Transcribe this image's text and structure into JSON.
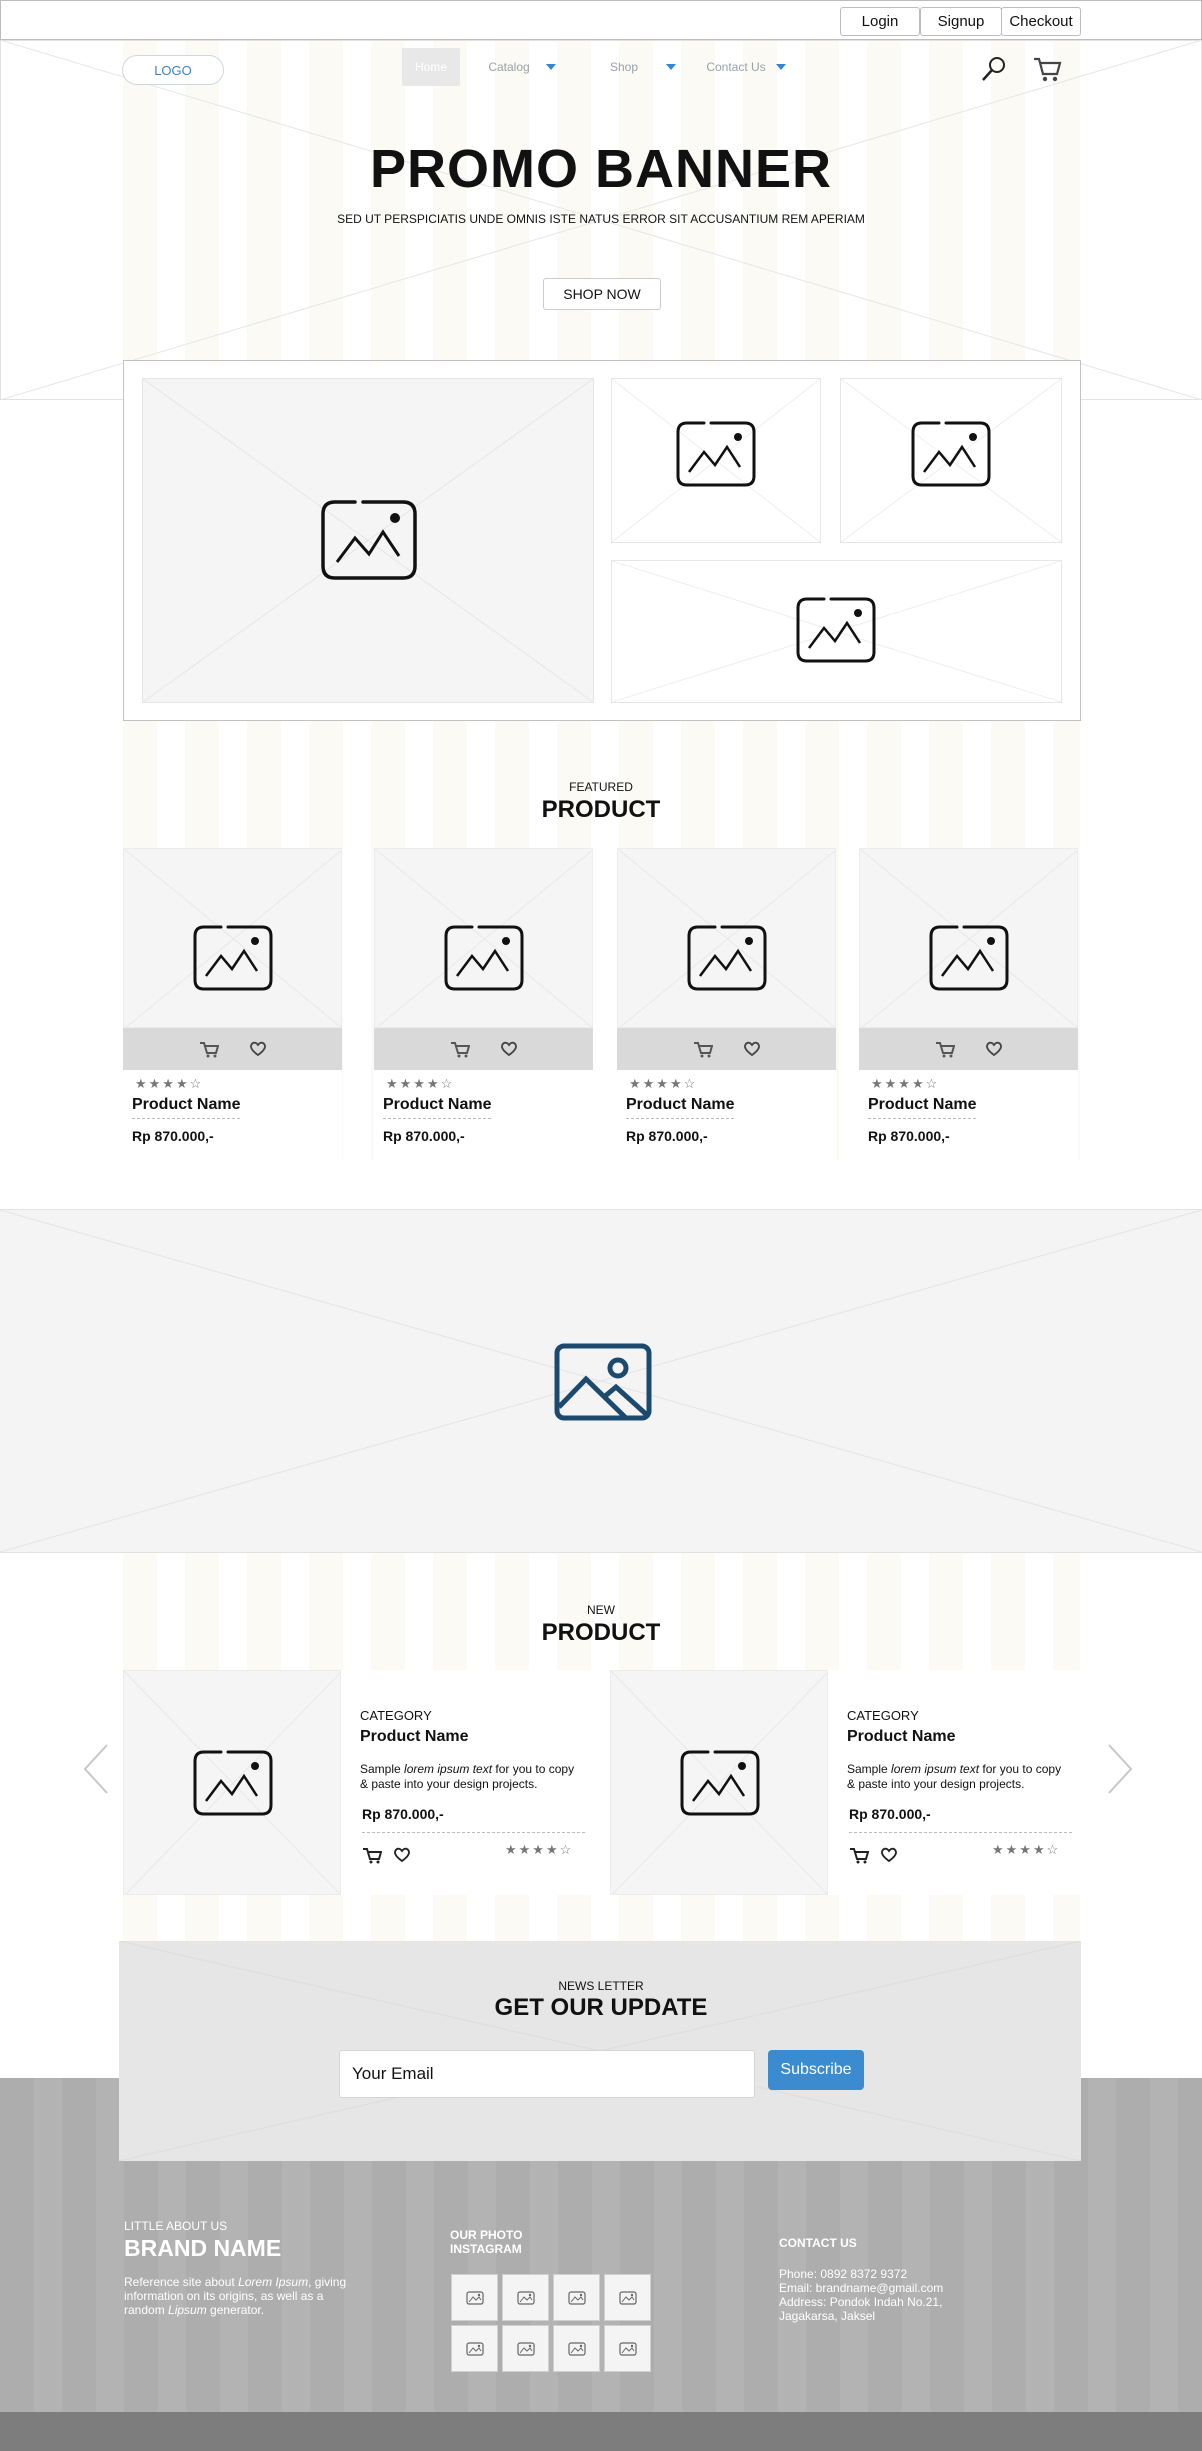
{
  "topbar": {
    "login": "Login",
    "signup": "Signup",
    "checkout": "Checkout"
  },
  "header": {
    "logo": "LOGO",
    "nav": [
      {
        "label": "Home",
        "active": true
      },
      {
        "label": "Catalog"
      },
      {
        "label": "Shop"
      },
      {
        "label": "Contact Us"
      }
    ]
  },
  "hero": {
    "title": "PROMO BANNER",
    "subtitle": "SED UT PERSPICIATIS UNDE OMNIS ISTE NATUS ERROR SIT ACCUSANTIUM REM APERIAM",
    "button": "SHOP NOW"
  },
  "featured": {
    "small": "FEATURED",
    "big": "PRODUCT",
    "products": [
      {
        "name": "Product Name",
        "price": "Rp 870.000,-",
        "stars": "★★★★☆"
      },
      {
        "name": "Product Name",
        "price": "Rp 870.000,-",
        "stars": "★★★★☆"
      },
      {
        "name": "Product Name",
        "price": "Rp 870.000,-",
        "stars": "★★★★☆"
      },
      {
        "name": "Product Name",
        "price": "Rp 870.000,-",
        "stars": "★★★★☆"
      }
    ]
  },
  "new_products": {
    "small": "NEW",
    "big": "PRODUCT",
    "items": [
      {
        "category": "CATEGORY",
        "name": "Product Name",
        "desc_pre": "Sample ",
        "desc_em": "lorem ipsum text",
        "desc_post": " for you to copy & paste into your design projects.",
        "price": "Rp 870.000,-",
        "stars": "★★★★☆"
      },
      {
        "category": "CATEGORY",
        "name": "Product Name",
        "desc_pre": "Sample ",
        "desc_em": "lorem ipsum text",
        "desc_post": " for you to copy & paste into your design projects.",
        "price": "Rp 870.000,-",
        "stars": "★★★★☆"
      }
    ]
  },
  "newsletter": {
    "small": "NEWS LETTER",
    "big": "GET OUR UPDATE",
    "placeholder": "Your Email",
    "button": "Subscribe"
  },
  "footer": {
    "about_small": "LITTLE ABOUT US",
    "brand": "BRAND NAME",
    "about_pre": "Reference site about ",
    "about_em1": "Lorem Ipsum",
    "about_mid": ", giving information on its origins, as well as a random ",
    "about_em2": "Lipsum",
    "about_post": " generator.",
    "photo_title": "OUR PHOTO INSTAGRAM",
    "contact_title": "CONTACT US",
    "phone": "Phone: 0892 8372 9372",
    "email": "Email: brandname@gmail.com",
    "address": "Address: Pondok Indah No.21, Jagakarsa, Jaksel"
  },
  "icons": {
    "search": "search-icon",
    "cart": "cart-icon",
    "heart": "heart-icon",
    "image": "image-placeholder-icon",
    "arrow_left": "chevron-left-icon",
    "arrow_right": "chevron-right-icon"
  },
  "colors": {
    "accent": "#3b8bd1",
    "banner_icon": "#1c4a6e",
    "footer": "#adadad",
    "footer_bar": "#7d7d7d"
  }
}
